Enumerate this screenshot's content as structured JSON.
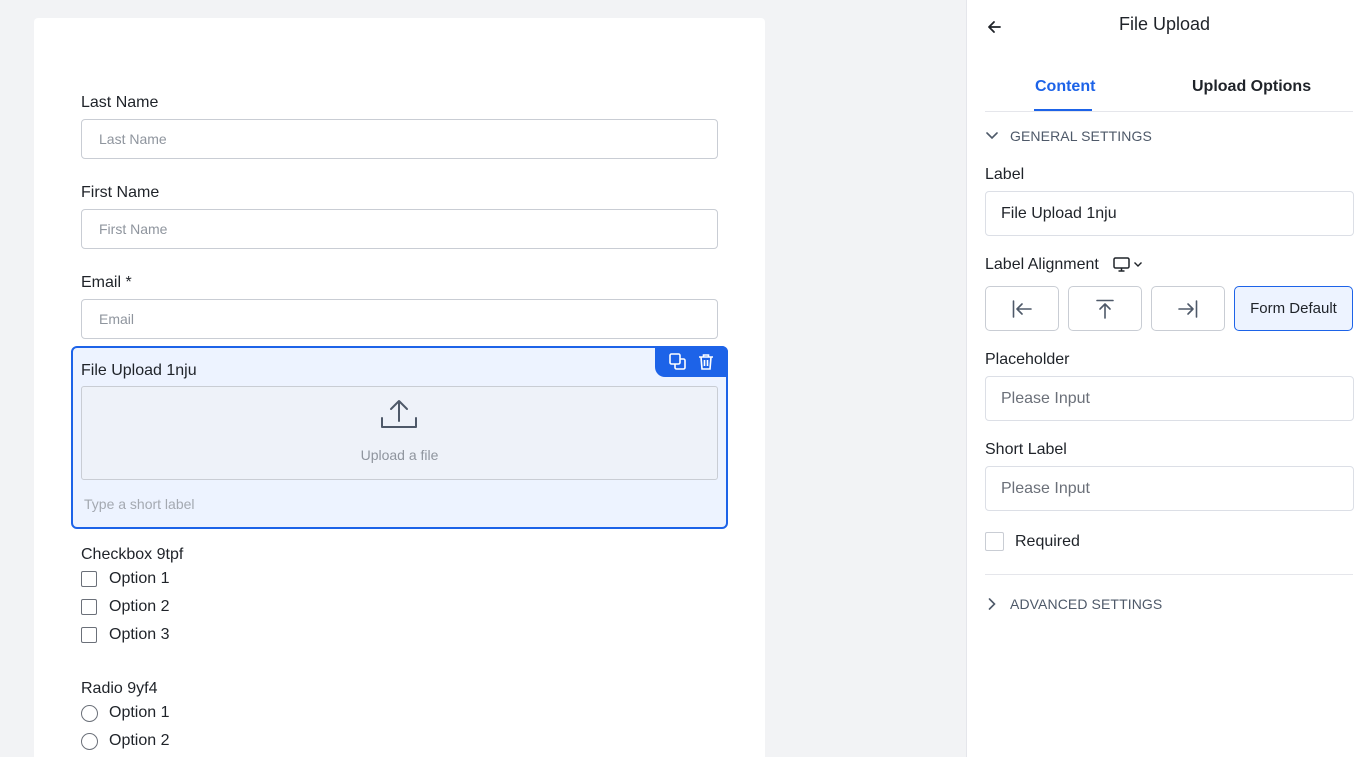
{
  "form": {
    "last_name": {
      "label": "Last Name",
      "placeholder": "Last Name"
    },
    "first_name": {
      "label": "First Name",
      "placeholder": "First Name"
    },
    "email": {
      "label": "Email *",
      "placeholder": "Email"
    },
    "file_upload": {
      "label": "File Upload 1nju",
      "dropzone_text": "Upload a file",
      "short_label_placeholder": "Type a short label"
    },
    "checkbox_group": {
      "label": "Checkbox 9tpf",
      "options": [
        "Option 1",
        "Option 2",
        "Option 3"
      ]
    },
    "radio_group": {
      "label": "Radio 9yf4",
      "options": [
        "Option 1",
        "Option 2"
      ]
    }
  },
  "panel": {
    "title": "File Upload",
    "tabs": [
      "Content",
      "Upload Options"
    ],
    "active_tab": "Content",
    "general_settings": "GENERAL SETTINGS",
    "label_field": {
      "label": "Label",
      "value": "File Upload 1nju"
    },
    "label_alignment": {
      "label": "Label Alignment",
      "options": [
        "align-left-icon",
        "align-top-icon",
        "align-right-icon",
        "Form Default"
      ],
      "selected": "Form Default"
    },
    "placeholder_field": {
      "label": "Placeholder",
      "value": "Please Input"
    },
    "short_label_field": {
      "label": "Short Label",
      "value": "Please Input"
    },
    "required": {
      "label": "Required",
      "checked": false
    },
    "advanced_settings": "ADVANCED SETTINGS"
  },
  "colors": {
    "accent": "#1d63e8",
    "selected_bg": "#edf3ff",
    "border": "#c9cdd4"
  }
}
